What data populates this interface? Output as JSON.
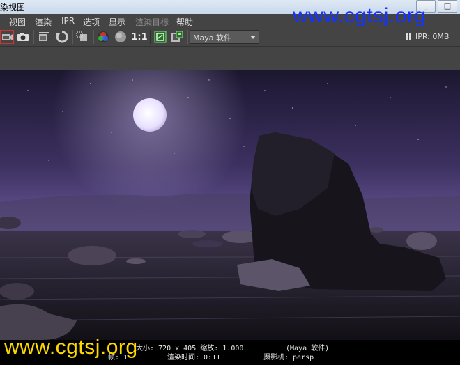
{
  "window": {
    "title": "染视图",
    "minimize_label": "_",
    "maximize_label": "□"
  },
  "menu": {
    "items": [
      {
        "label": "视图"
      },
      {
        "label": "渲染"
      },
      {
        "label": "IPR"
      },
      {
        "label": "选项"
      },
      {
        "label": "显示"
      },
      {
        "label": "渲染目标"
      },
      {
        "label": "帮助"
      }
    ]
  },
  "toolbar": {
    "one_to_one_label": "1:1",
    "renderer_select": "Maya 软件",
    "ipr_status": "IPR: 0MB"
  },
  "statusbar": {
    "size_text": "大小: 720 x 405 缩放: 1.000",
    "renderer_text": "(Maya 软件)",
    "frame_text": "帧: 1",
    "render_time_text": "渲染时间: 0:11",
    "camera_text": "摄影机: persp"
  },
  "watermark": {
    "text": "www.cgtsj.org",
    "top_color": "#1533ff",
    "bottom_color": "#ffd800"
  },
  "colors": {
    "panel_bg": "#444444",
    "statusbar_bg": "#000000",
    "sky_purple": "#6a5a9a"
  },
  "icons": [
    "render-frame-icon",
    "snapshot-icon",
    "ipr-render-icon",
    "refresh-icon",
    "render-region-icon",
    "color-channels-icon",
    "alpha-channel-icon",
    "real-size-icon",
    "keep-image-icon",
    "remove-image-icon",
    "pause-icon"
  ]
}
